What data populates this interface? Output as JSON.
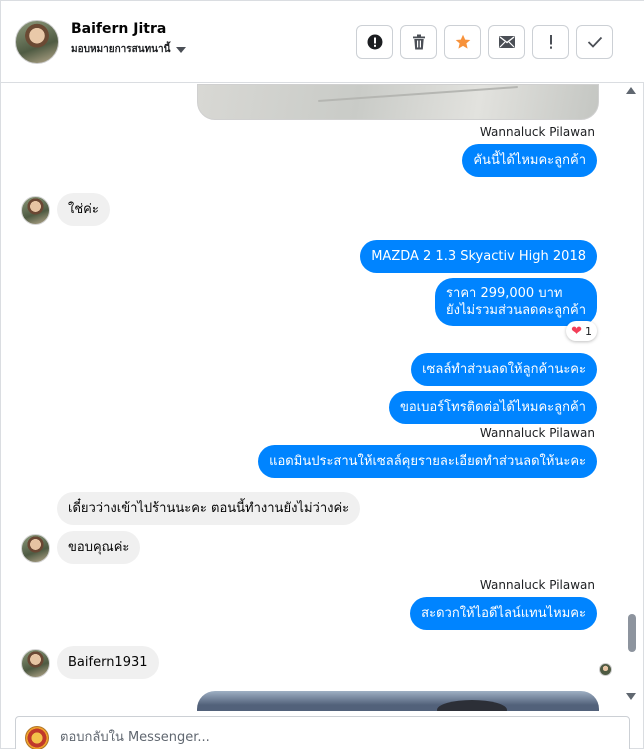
{
  "header": {
    "contact_name": "Baifern Jitra",
    "status_label": "มอบหมายการสนทนานี้",
    "actions": [
      {
        "icon": "alert-circle-icon",
        "glyph": "!"
      },
      {
        "icon": "trash-icon",
        "glyph": "🗑"
      },
      {
        "icon": "star-icon",
        "glyph": "★"
      },
      {
        "icon": "envelope-icon",
        "glyph": "✉"
      },
      {
        "icon": "exclamation-icon",
        "glyph": "!"
      },
      {
        "icon": "check-icon",
        "glyph": "✓"
      }
    ]
  },
  "messages": {
    "sender_1": "Wannaluck Pilawan",
    "out_1": "คันนี้ได้ไหมคะลูกค้า",
    "in_1": "ใช่ค่ะ",
    "out_2": "MAZDA 2 1.3 Skyactiv High  2018",
    "out_3_line1": "ราคา 299,000 บาท",
    "out_3_line2": "ยังไม่รวมส่วนลดคะลูกค้า",
    "reaction_count": "1",
    "out_4": "เซลล์ทำส่วนลดให้ลูกค้านะคะ",
    "out_5": "ขอเบอร์โทรติดต่อได้ไหมคะลูกค้า",
    "sender_2": "Wannaluck Pilawan",
    "out_6": "แอดมินประสานให้เซลล์คุยรายละเอียดทำส่วนลดให้นะคะ",
    "in_2": "เดี๋ยวว่างเข้าไปร้านนะคะ ตอนนี้ทำงานยังไม่ว่างค่ะ",
    "in_3": "ขอบคุณค่ะ",
    "sender_3": "Wannaluck Pilawan",
    "out_7": "สะดวกให้ไอดีไลน์แทนไหมคะ",
    "in_4": "Baifern1931"
  },
  "composer": {
    "placeholder": "ตอบกลับใน Messenger..."
  },
  "colors": {
    "outgoing_bubble": "#0084ff",
    "incoming_bubble": "#f0f0f0",
    "star_accent": "#f7923b"
  }
}
